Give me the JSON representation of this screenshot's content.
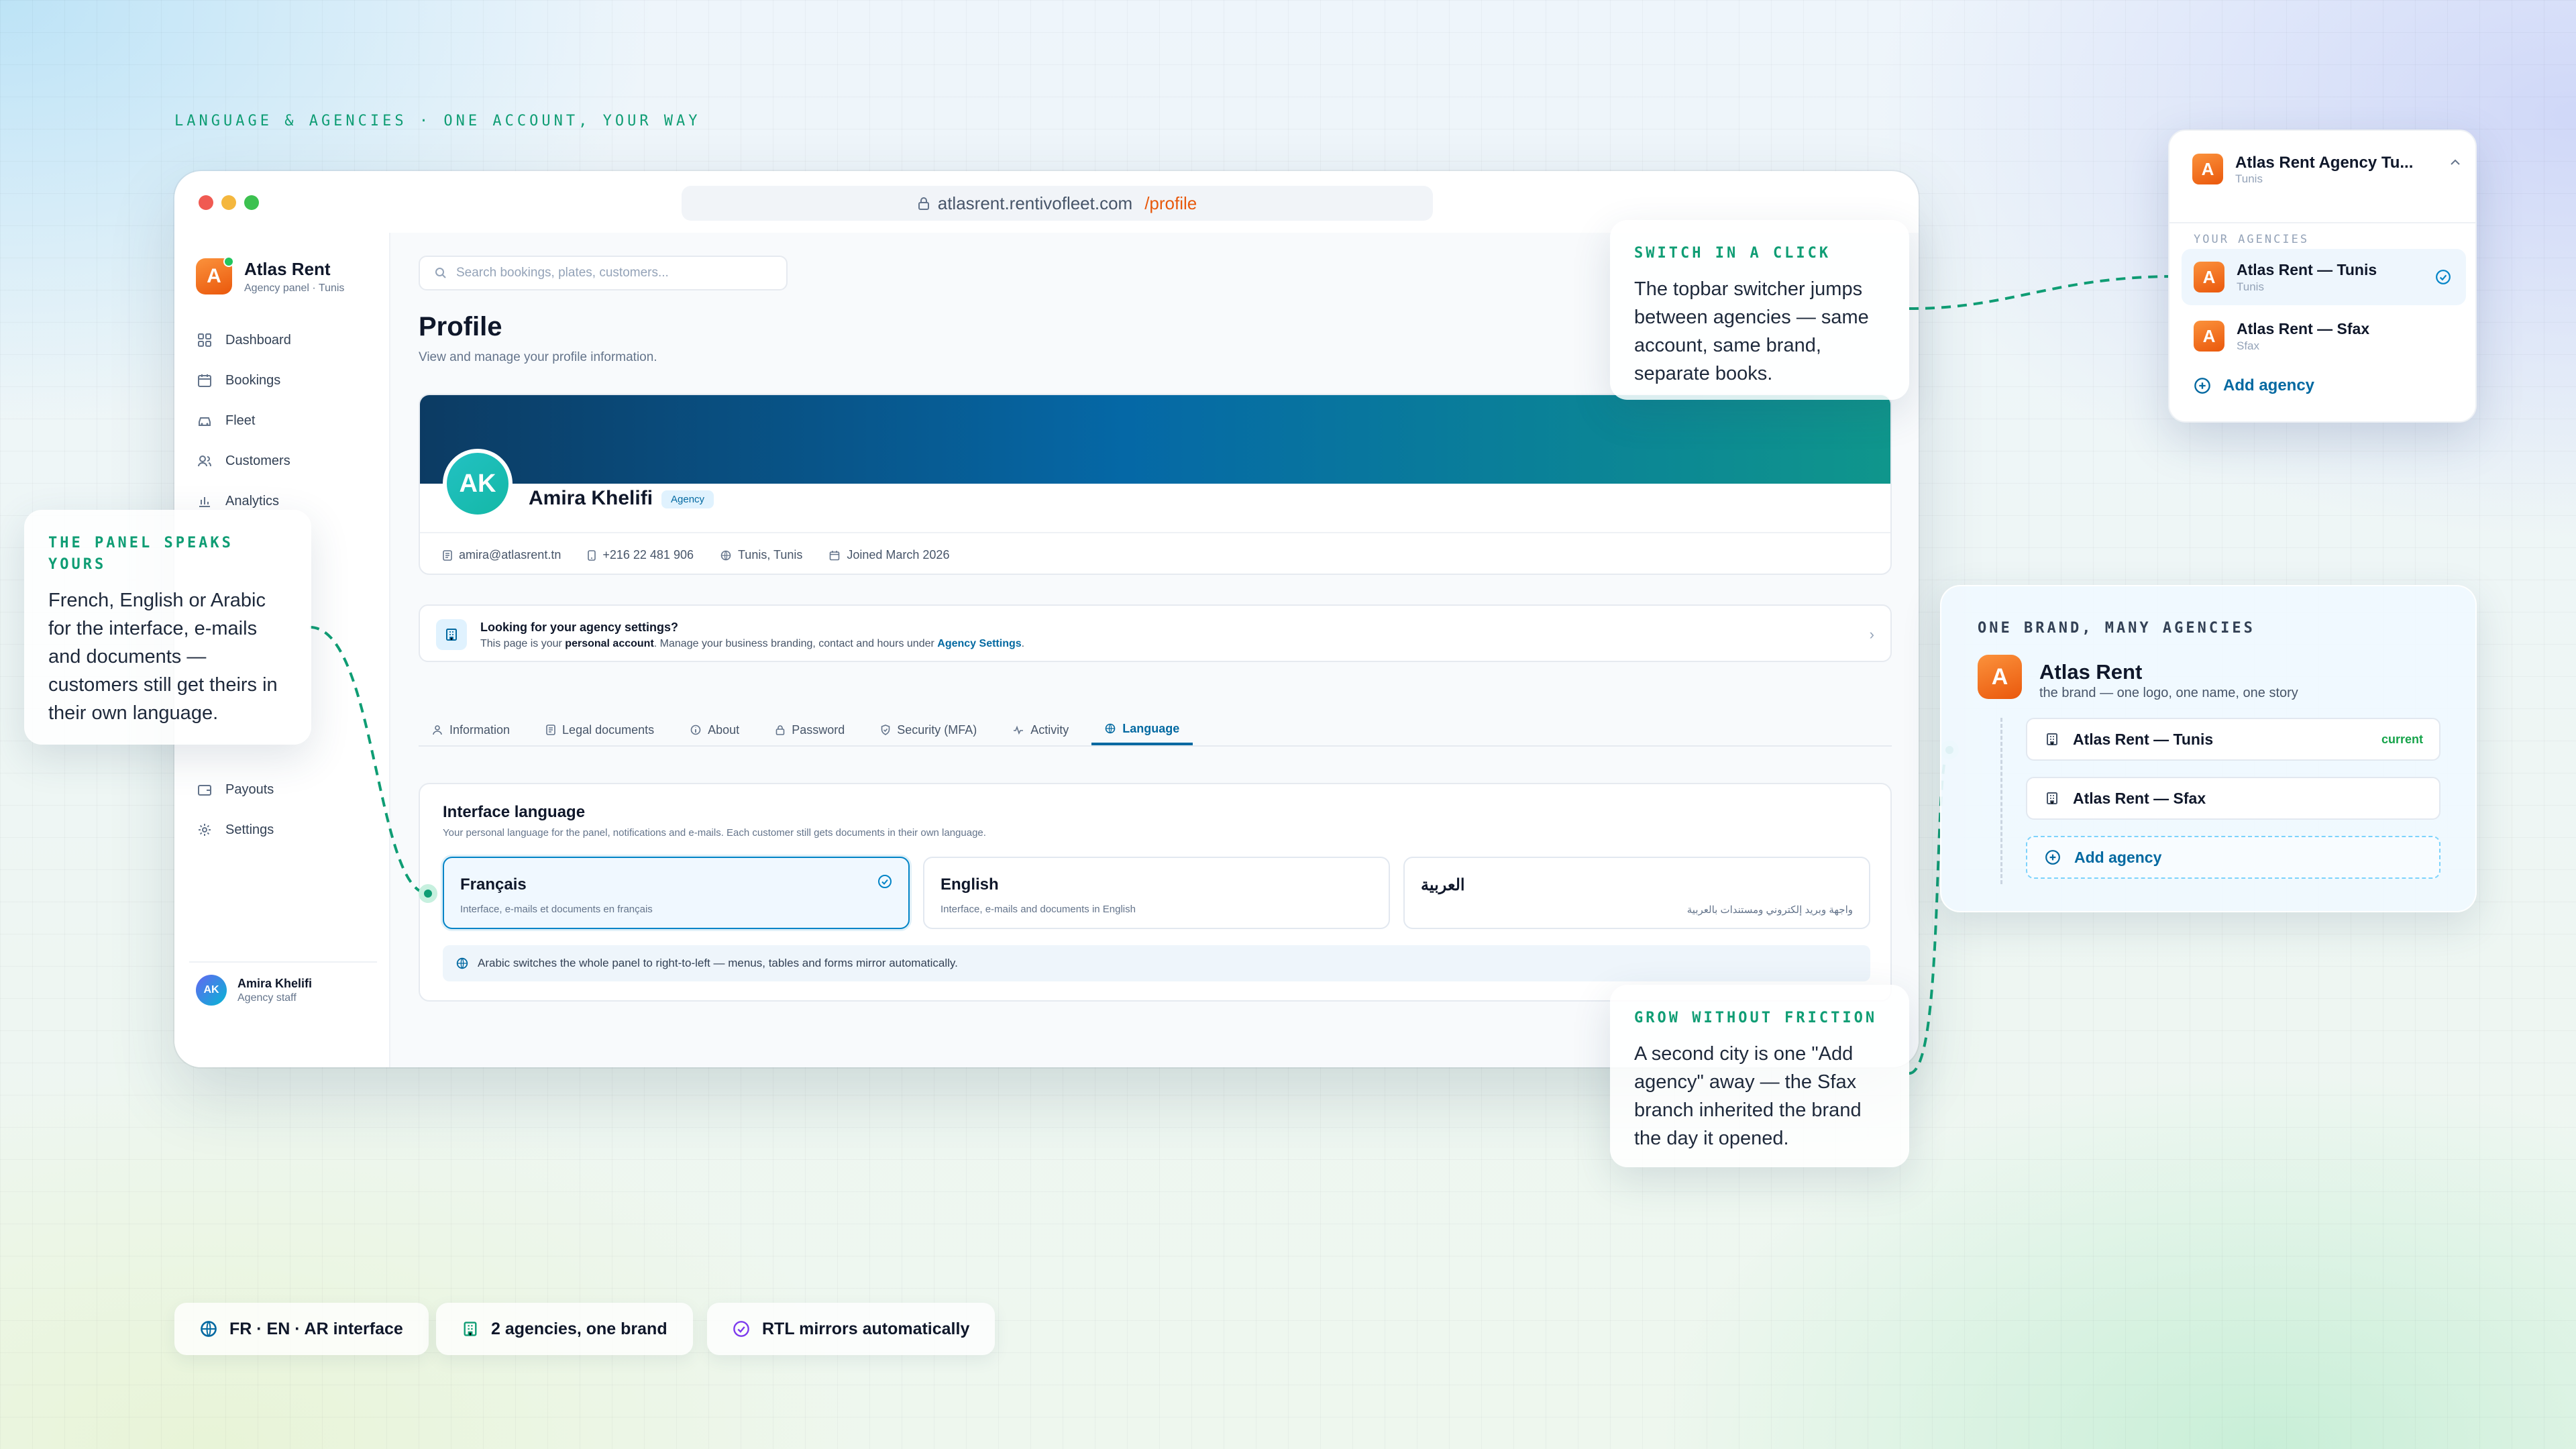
{
  "eyebrow": "LANGUAGE & AGENCIES · ONE ACCOUNT, YOUR WAY",
  "browser": {
    "url_host": "atlasrent.rentivofleet.com",
    "url_path": "/profile"
  },
  "sidebar": {
    "brand_name": "Atlas Rent",
    "brand_sub": "Agency panel · Tunis",
    "brand_letter": "A",
    "items": [
      {
        "label": "Dashboard",
        "icon": "grid-icon"
      },
      {
        "label": "Bookings",
        "icon": "calendar-icon"
      },
      {
        "label": "Fleet",
        "icon": "car-icon"
      },
      {
        "label": "Customers",
        "icon": "users-icon"
      },
      {
        "label": "Analytics",
        "icon": "bar-chart-icon"
      }
    ],
    "bottom_items": [
      {
        "label": "Payouts",
        "icon": "wallet-icon"
      },
      {
        "label": "Settings",
        "icon": "gear-icon"
      }
    ],
    "user_initials": "AK",
    "user_name": "Amira Khelifi",
    "user_role": "Agency staff"
  },
  "main": {
    "search_placeholder": "Search bookings, plates, customers...",
    "title": "Profile",
    "subtitle": "View and manage your profile information.",
    "profile": {
      "initials": "AK",
      "name": "Amira Khelifi",
      "badge": "Agency",
      "email": "amira@atlasrent.tn",
      "phone": "+216 22 481 906",
      "location": "Tunis, Tunis",
      "joined": "Joined March 2026"
    },
    "notice": {
      "title": "Looking for your agency settings?",
      "text_pre": "This page is your",
      "text_bold": "personal account",
      "text_mid": ". Manage your business branding, contact and hours under",
      "link": "Agency Settings",
      "text_end": "."
    },
    "tabs": [
      "Information",
      "Legal documents",
      "About",
      "Password",
      "Security (MFA)",
      "Activity",
      "Language"
    ],
    "active_tab": "Language",
    "language": {
      "heading": "Interface language",
      "sub": "Your personal language for the panel, notifications and e-mails. Each customer still gets documents in their own language.",
      "options": [
        {
          "name": "Français",
          "desc": "Interface, e-mails et documents en français",
          "selected": true
        },
        {
          "name": "English",
          "desc": "Interface, e-mails and documents in English",
          "selected": false
        },
        {
          "name": "العربية",
          "desc": "واجهة وبريد إلكتروني ومستندات بالعربية",
          "selected": false
        }
      ],
      "rtl_note": "Arabic switches the whole panel to right-to-left — menus, tables and forms mirror automatically."
    }
  },
  "callouts": {
    "panel": {
      "key": "THE PANEL SPEAKS YOURS",
      "body": "French, English or Arabic for the interface, e-mails and documents — customers still get theirs in their own language."
    },
    "switch": {
      "key": "SWITCH IN A CLICK",
      "body": "The topbar switcher jumps between agencies — same account, same brand, separate books."
    },
    "grow": {
      "key": "GROW WITHOUT FRICTION",
      "body": "A second city is one \"Add agency\" away — the Sfax branch inherited the brand the day it opened."
    }
  },
  "switcher": {
    "current_name": "Atlas Rent Agency Tu...",
    "current_loc": "Tunis",
    "section_label": "YOUR AGENCIES",
    "agencies": [
      {
        "name": "Atlas Rent — Tunis",
        "loc": "Tunis",
        "current": true
      },
      {
        "name": "Atlas Rent — Sfax",
        "loc": "Sfax",
        "current": false
      }
    ],
    "add_label": "Add agency"
  },
  "brand_card": {
    "key": "ONE BRAND, MANY AGENCIES",
    "name": "Atlas Rent",
    "sub": "the brand — one logo, one name, one story",
    "agencies": [
      {
        "name": "Atlas Rent — Tunis",
        "tag": "current"
      },
      {
        "name": "Atlas Rent — Sfax",
        "tag": ""
      }
    ],
    "add_label": "Add agency"
  },
  "chips": [
    {
      "label": "FR · EN · AR interface",
      "icon": "globe-icon"
    },
    {
      "label": "2 agencies, one brand",
      "icon": "building-icon"
    },
    {
      "label": "RTL mirrors automatically",
      "icon": "check-circle-icon"
    }
  ],
  "colors": {
    "accent": "#0369a1",
    "brand_orange": "#ea580c",
    "callout_green": "#0f9d74",
    "success": "#16a34a"
  }
}
